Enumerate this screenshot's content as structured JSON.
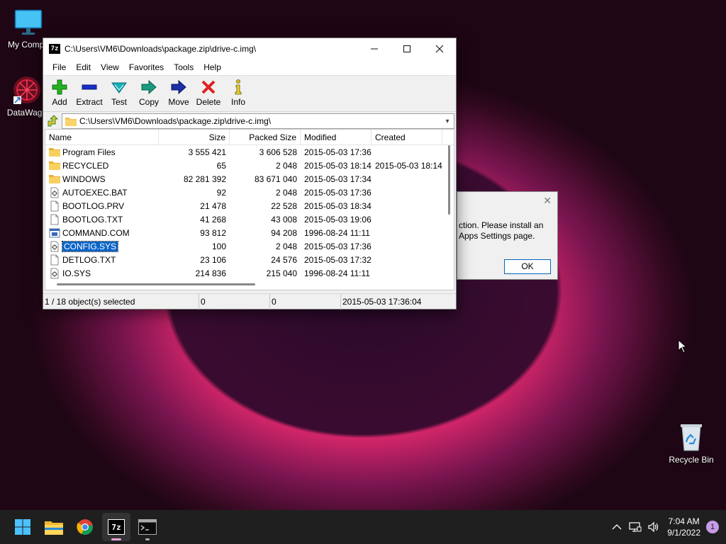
{
  "desktop": {
    "icons": [
      {
        "label": "My Compu",
        "icon": "monitor-icon"
      },
      {
        "label": "DataWago",
        "icon": "datawago-icon"
      },
      {
        "label": "Recycle Bin",
        "icon": "recycle-bin-icon"
      }
    ]
  },
  "window": {
    "app_badge": "7z",
    "title": "C:\\Users\\VM6\\Downloads\\package.zip\\drive-c.img\\",
    "menu": [
      "File",
      "Edit",
      "View",
      "Favorites",
      "Tools",
      "Help"
    ],
    "toolbar": [
      {
        "label": "Add",
        "icon": "plus-icon",
        "color": "#22b020"
      },
      {
        "label": "Extract",
        "icon": "minus-icon",
        "color": "#1a2fc8"
      },
      {
        "label": "Test",
        "icon": "check-icon",
        "color": "#1aa0a8"
      },
      {
        "label": "Copy",
        "icon": "copy-arrow-icon",
        "color": "#1a9a80"
      },
      {
        "label": "Move",
        "icon": "move-arrow-icon",
        "color": "#1a2fa8"
      },
      {
        "label": "Delete",
        "icon": "delete-x-icon",
        "color": "#e02020"
      },
      {
        "label": "Info",
        "icon": "info-icon",
        "color": "#d8c020"
      }
    ],
    "address": "C:\\Users\\VM6\\Downloads\\package.zip\\drive-c.img\\",
    "columns": [
      "Name",
      "Size",
      "Packed Size",
      "Modified",
      "Created"
    ],
    "files": [
      {
        "name": "Program Files",
        "type": "folder",
        "size": "3 555 421",
        "packed": "3 606 528",
        "modified": "2015-05-03 17:36",
        "created": ""
      },
      {
        "name": "RECYCLED",
        "type": "folder",
        "size": "65",
        "packed": "2 048",
        "modified": "2015-05-03 18:14",
        "created": "2015-05-03 18:14"
      },
      {
        "name": "WINDOWS",
        "type": "folder",
        "size": "82 281 392",
        "packed": "83 671 040",
        "modified": "2015-05-03 17:34",
        "created": ""
      },
      {
        "name": "AUTOEXEC.BAT",
        "type": "sys",
        "size": "92",
        "packed": "2 048",
        "modified": "2015-05-03 17:36",
        "created": ""
      },
      {
        "name": "BOOTLOG.PRV",
        "type": "doc",
        "size": "21 478",
        "packed": "22 528",
        "modified": "2015-05-03 18:34",
        "created": ""
      },
      {
        "name": "BOOTLOG.TXT",
        "type": "doc",
        "size": "41 268",
        "packed": "43 008",
        "modified": "2015-05-03 19:06",
        "created": ""
      },
      {
        "name": "COMMAND.COM",
        "type": "exe",
        "size": "93 812",
        "packed": "94 208",
        "modified": "1996-08-24 11:11",
        "created": ""
      },
      {
        "name": "CONFIG.SYS",
        "type": "sys",
        "size": "100",
        "packed": "2 048",
        "modified": "2015-05-03 17:36",
        "created": "",
        "selected": true
      },
      {
        "name": "DETLOG.TXT",
        "type": "doc",
        "size": "23 106",
        "packed": "24 576",
        "modified": "2015-05-03 17:32",
        "created": ""
      },
      {
        "name": "IO.SYS",
        "type": "sys",
        "size": "214 836",
        "packed": "215 040",
        "modified": "1996-08-24 11:11",
        "created": ""
      }
    ],
    "status": {
      "selection": "1 / 18 object(s) selected",
      "size": "0",
      "packed": "0",
      "modified": "2015-05-03 17:36:04"
    }
  },
  "dialog": {
    "message": "ction. Please install an\nApps Settings page.",
    "ok_label": "OK"
  },
  "taskbar": {
    "apps": [
      "start-icon",
      "file-explorer-icon",
      "chrome-icon",
      "7zip-icon",
      "terminal-icon"
    ],
    "active_app": "7zip-icon",
    "time": "7:04 AM",
    "date": "9/1/2022",
    "notifications": "1"
  }
}
